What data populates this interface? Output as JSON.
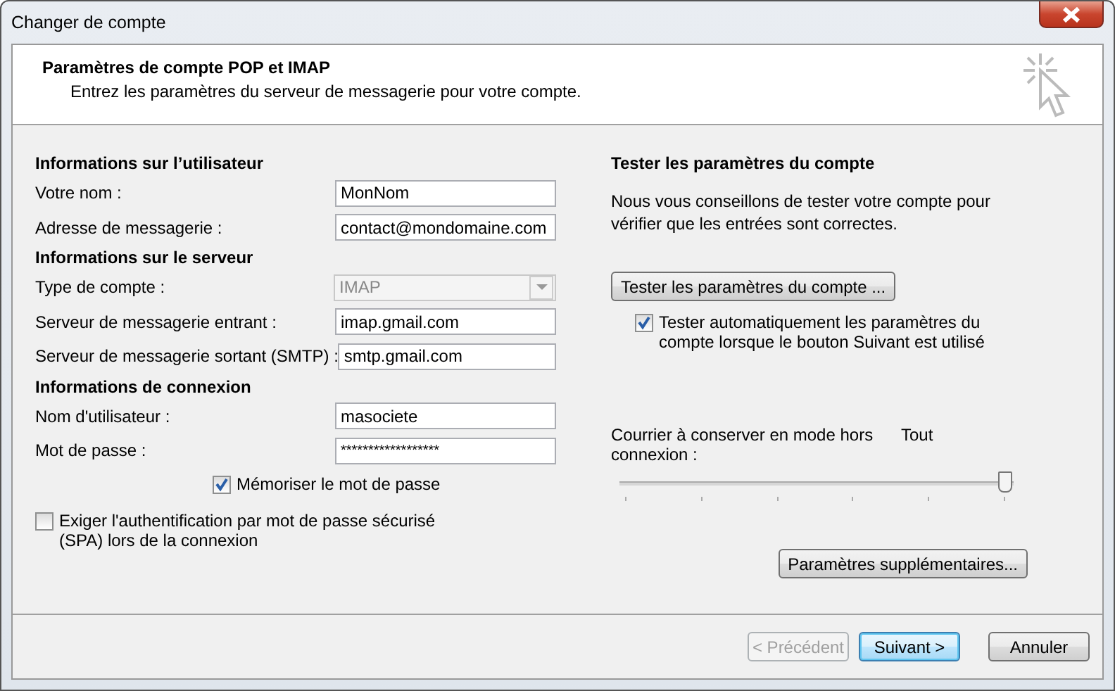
{
  "window": {
    "title": "Changer de compte"
  },
  "header": {
    "title": "Paramètres de compte POP et IMAP",
    "subtitle": "Entrez les paramètres du serveur de messagerie pour votre compte."
  },
  "left_sections": [
    {
      "heading": "Informations sur l’utilisateur",
      "fields": [
        {
          "kind": "text",
          "label": "Votre nom :",
          "value": "MonNom",
          "disabled": false
        },
        {
          "kind": "text",
          "label": "Adresse de messagerie :",
          "value": "contact@mondomaine.com",
          "disabled": false
        }
      ]
    },
    {
      "heading": "Informations sur le serveur",
      "fields": [
        {
          "kind": "dropdown",
          "label": "Type de compte :",
          "value": "IMAP",
          "disabled": true
        },
        {
          "kind": "text",
          "label": "Serveur de messagerie entrant :",
          "value": "imap.gmail.com",
          "disabled": false
        },
        {
          "kind": "text",
          "label": "Serveur de messagerie sortant (SMTP) :",
          "value": "smtp.gmail.com",
          "disabled": false
        }
      ]
    },
    {
      "heading": "Informations de connexion",
      "fields": [
        {
          "kind": "text",
          "label": "Nom d'utilisateur :",
          "value": "masociete",
          "disabled": false
        },
        {
          "kind": "password",
          "label": "Mot de passe :",
          "value": "******************",
          "disabled": false
        }
      ]
    }
  ],
  "remember_password": {
    "label": "Mémoriser le mot de passe",
    "checked": true
  },
  "require_spa": {
    "label": "Exiger l'authentification par mot de passe sécurisé (SPA) lors de la connexion",
    "checked": false
  },
  "test_panel": {
    "heading": "Tester les paramètres du compte",
    "description": "Nous vous conseillons de tester votre compte pour vérifier que les entrées sont correctes.",
    "test_button": "Tester les paramètres du compte ...",
    "auto_test": {
      "label": "Tester automatiquement les paramètres du compte lorsque le bouton Suivant est utilisé",
      "checked": true
    }
  },
  "offline_mail": {
    "label": "Courrier à conserver en mode hors connexion :",
    "reading": "Tout",
    "level": 1
  },
  "more_settings_button": "Paramètres supplémentaires...",
  "buttons": [
    {
      "label": "< Précédent",
      "disabled": true,
      "default": false
    },
    {
      "label": "Suivant >",
      "disabled": false,
      "default": true
    },
    {
      "label": "Annuler",
      "disabled": false,
      "default": false
    }
  ]
}
